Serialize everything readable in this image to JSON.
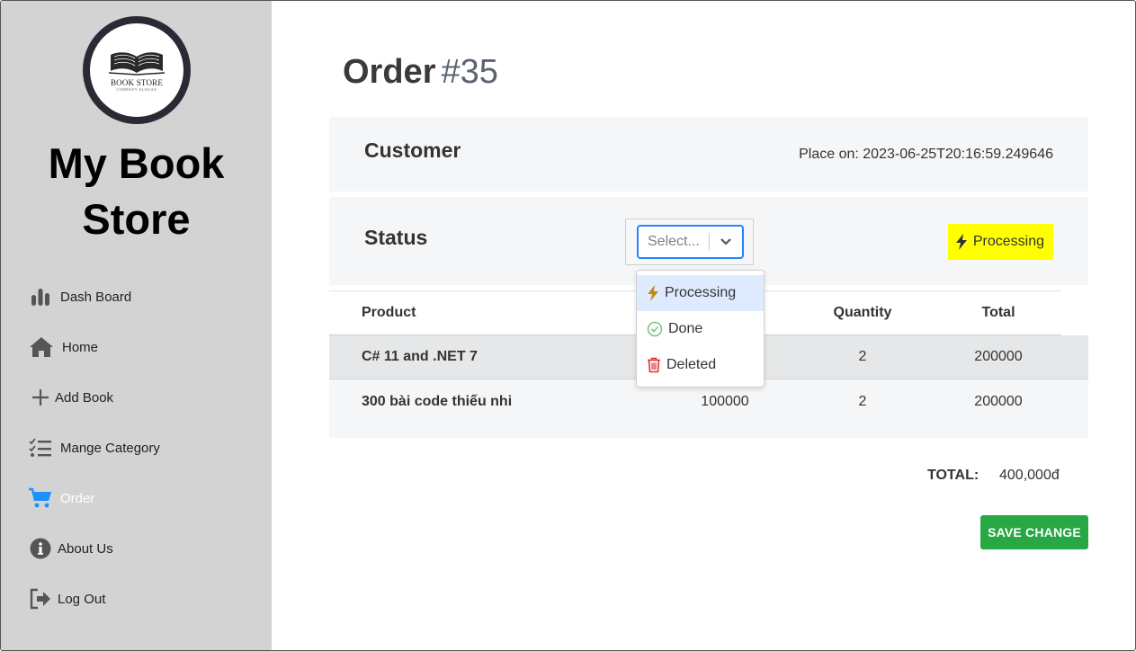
{
  "sidebar": {
    "logo_text": "BOOK STORE",
    "logo_subtext": "COMPANY SLOGAN",
    "brand_line1": "My Book",
    "brand_line2": "Store",
    "items": [
      {
        "label": "Dash Board",
        "icon": "bar-chart-icon"
      },
      {
        "label": "Home",
        "icon": "home-icon"
      },
      {
        "label": "Add Book",
        "icon": "plus-icon"
      },
      {
        "label": "Mange Category",
        "icon": "checklist-icon"
      },
      {
        "label": "Order",
        "icon": "cart-icon",
        "active": true
      },
      {
        "label": "About Us",
        "icon": "info-icon"
      },
      {
        "label": "Log Out",
        "icon": "logout-icon"
      }
    ]
  },
  "order": {
    "title": "Order",
    "number": "#35"
  },
  "customer": {
    "label": "Customer",
    "placed_on": "Place on: 2023-06-25T20:16:59.249646"
  },
  "status": {
    "label": "Status",
    "select_placeholder": "Select...",
    "current": "Processing",
    "badge_color": "#ffff00",
    "options": [
      {
        "label": "Processing",
        "icon": "bolt-icon",
        "highlighted": true
      },
      {
        "label": "Done",
        "icon": "check-circle-icon"
      },
      {
        "label": "Deleted",
        "icon": "trash-icon"
      }
    ]
  },
  "table": {
    "headers": {
      "product": "Product",
      "quantity": "Quantity",
      "total": "Total"
    },
    "rows": [
      {
        "product": "C# 11 and .NET 7",
        "price": "",
        "quantity": "2",
        "total": "200000"
      },
      {
        "product": "300 bài code thiếu nhi",
        "price": "100000",
        "quantity": "2",
        "total": "200000"
      }
    ]
  },
  "summary": {
    "total_label": "TOTAL:",
    "total_value": "400,000đ"
  },
  "actions": {
    "save_label": "SAVE CHANGE"
  },
  "colors": {
    "sidebar_bg": "#d3d3d3",
    "active_nav_icon": "#1e90ff",
    "save_button": "#28a745",
    "select_focus": "#2684ff"
  }
}
